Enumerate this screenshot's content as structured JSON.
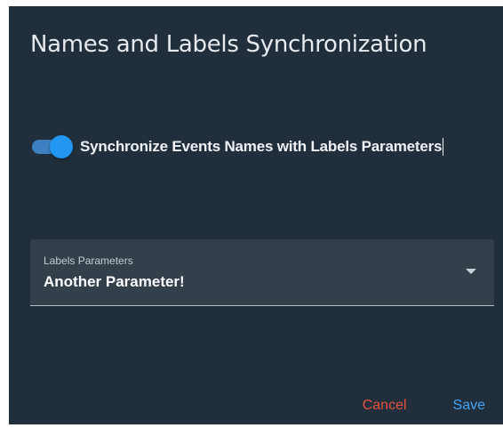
{
  "dialog": {
    "title": "Names and Labels Synchronization",
    "toggle": {
      "label": "Synchronize Events Names with Labels Parameters",
      "checked": true,
      "track_color": "#3d7fc0",
      "thumb_color": "#2196f3"
    },
    "select": {
      "label": "Labels Parameters",
      "value": "Another Parameter!"
    },
    "actions": {
      "cancel_label": "Cancel",
      "cancel_color": "#e5533d",
      "save_label": "Save",
      "save_color": "#42a5f5"
    }
  }
}
